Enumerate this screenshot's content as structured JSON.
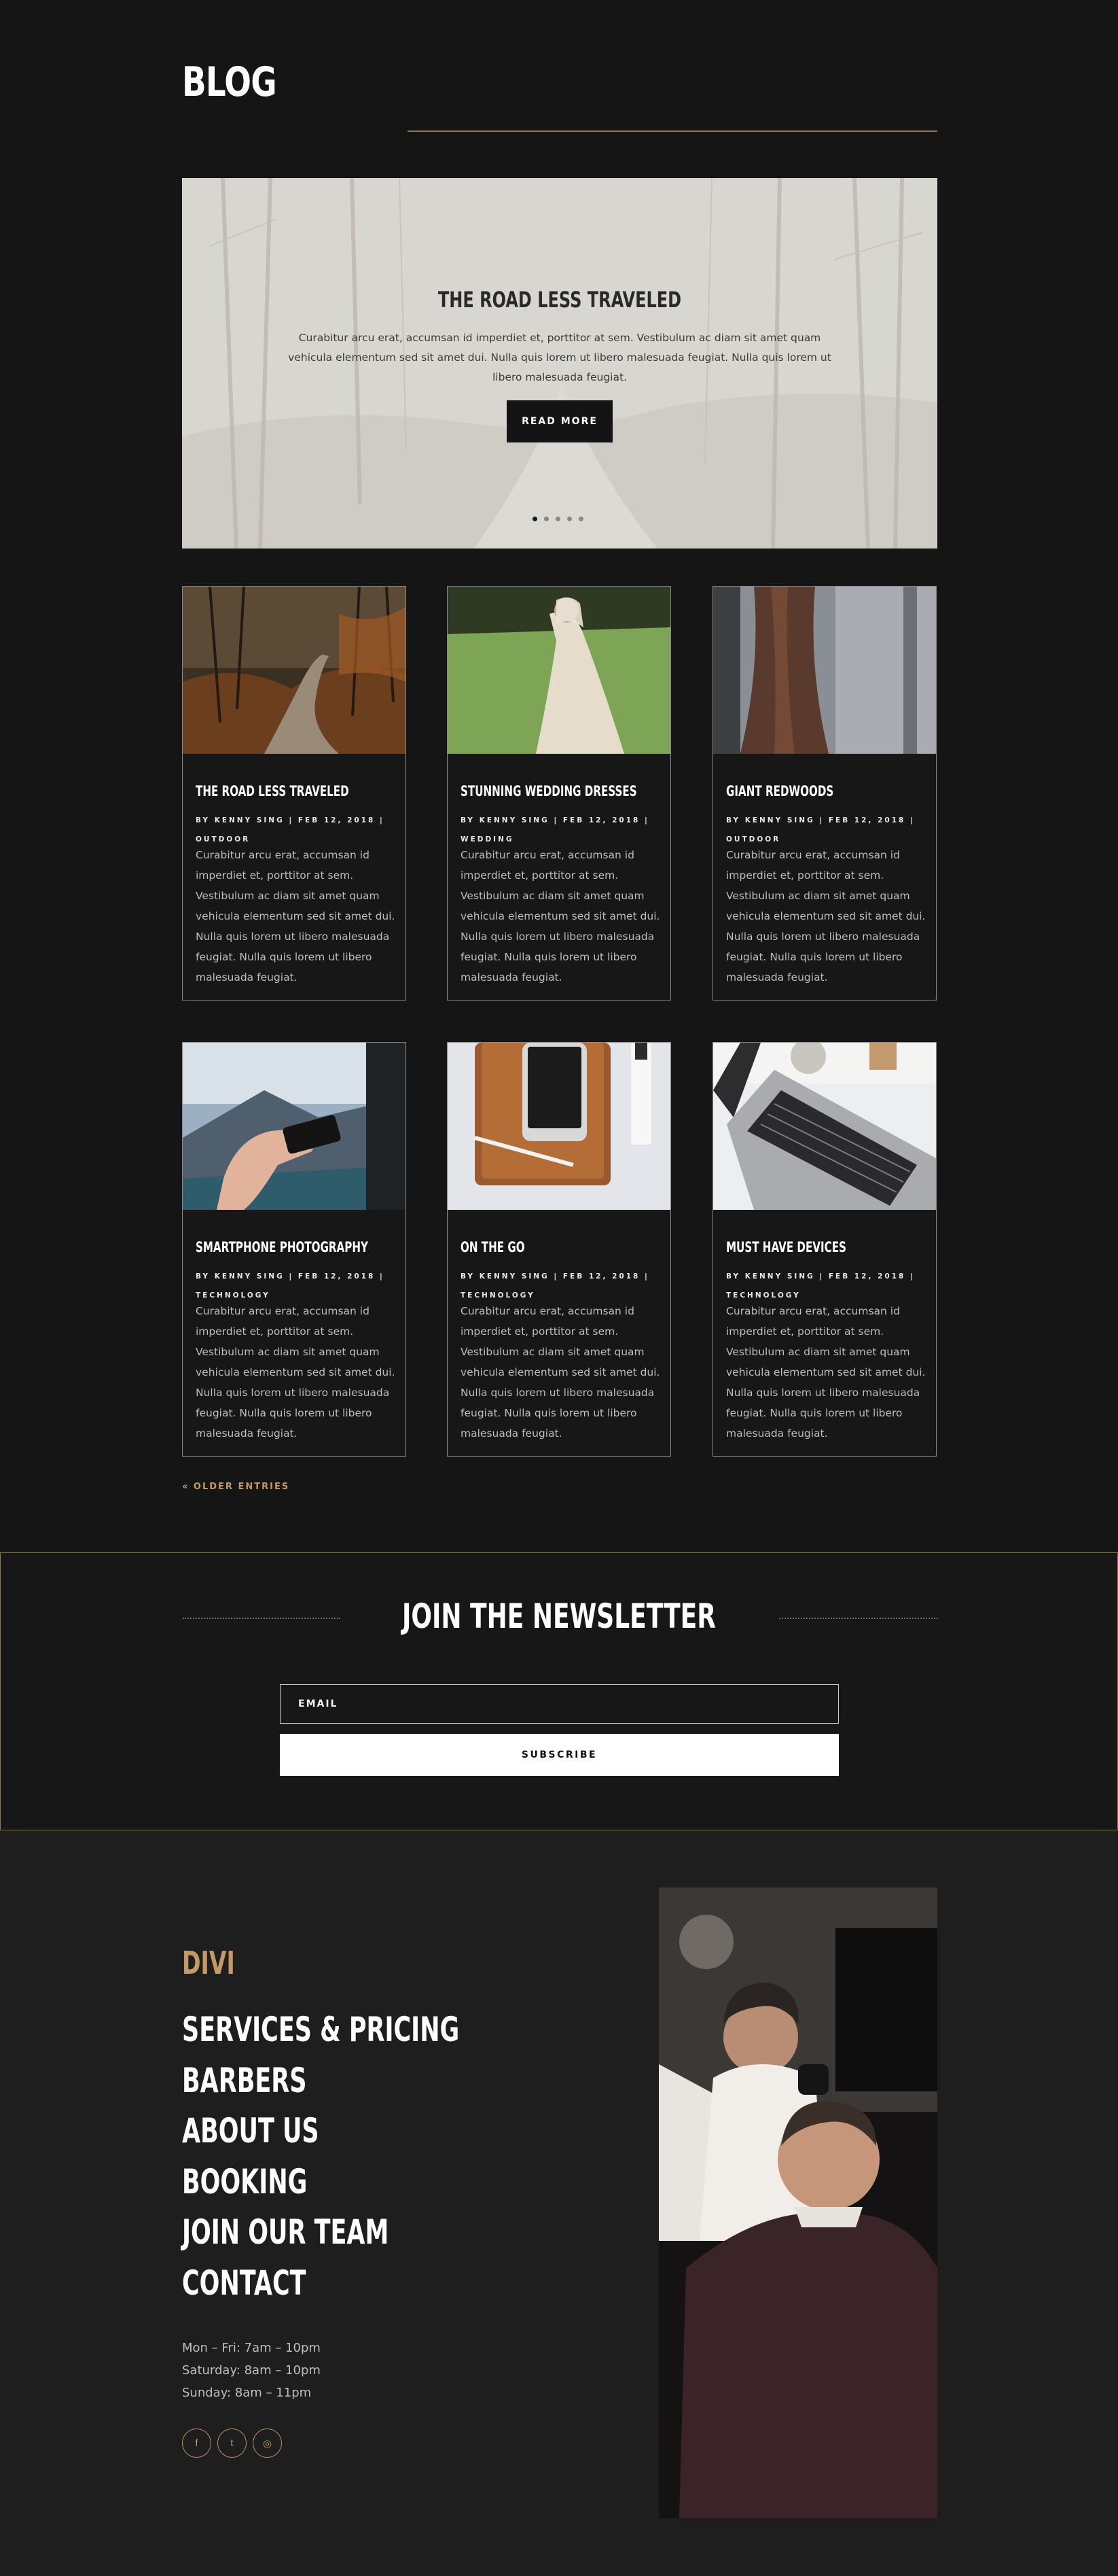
{
  "blog": {
    "title": "BLOG"
  },
  "slider": {
    "title": "THE ROAD LESS TRAVELED",
    "text": "Curabitur arcu erat, accumsan id imperdiet et, porttitor at sem. Vestibulum ac diam sit amet quam vehicula elementum sed sit amet dui. Nulla quis lorem ut libero malesuada feugiat. Nulla quis lorem ut libero malesuada feugiat.",
    "button": "READ MORE",
    "slide_count": 5,
    "active_slide": 1
  },
  "posts": [
    {
      "title": "THE ROAD LESS TRAVELED",
      "meta_line1": "BY KENNY SING | FEB 12, 2018 |",
      "meta_line2": "OUTDOOR",
      "excerpt": "Curabitur arcu erat, accumsan id imperdiet et, porttitor at sem. Vestibulum ac diam sit amet quam vehicula elementum sed sit amet dui. Nulla quis lorem ut libero malesuada feugiat. Nulla quis lorem ut libero malesuada feugiat.",
      "image": "forest-road-photo"
    },
    {
      "title": "STUNNING WEDDING DRESSES",
      "meta_line1": "BY KENNY SING | FEB 12, 2018 |",
      "meta_line2": "WEDDING",
      "excerpt": "Curabitur arcu erat, accumsan id imperdiet et, porttitor at sem. Vestibulum ac diam sit amet quam vehicula elementum sed sit amet dui. Nulla quis lorem ut libero malesuada feugiat. Nulla quis lorem ut libero malesuada feugiat.",
      "image": "wedding-dress-photo"
    },
    {
      "title": "GIANT REDWOODS",
      "meta_line1": "BY KENNY SING | FEB 12, 2018 |",
      "meta_line2": "OUTDOOR",
      "excerpt": "Curabitur arcu erat, accumsan id imperdiet et, porttitor at sem. Vestibulum ac diam sit amet quam vehicula elementum sed sit amet dui. Nulla quis lorem ut libero malesuada feugiat. Nulla quis lorem ut libero malesuada feugiat.",
      "image": "redwood-tree-photo"
    },
    {
      "title": "SMARTPHONE PHOTOGRAPHY",
      "meta_line1": "BY KENNY SING | FEB 12, 2018 |",
      "meta_line2": "TECHNOLOGY",
      "excerpt": "Curabitur arcu erat, accumsan id imperdiet et, porttitor at sem. Vestibulum ac diam sit amet quam vehicula elementum sed sit amet dui. Nulla quis lorem ut libero malesuada feugiat. Nulla quis lorem ut libero malesuada feugiat.",
      "image": "smartphone-photo"
    },
    {
      "title": "ON THE GO",
      "meta_line1": "BY KENNY SING | FEB 12, 2018 |",
      "meta_line2": "TECHNOLOGY",
      "excerpt": "Curabitur arcu erat, accumsan id imperdiet et, porttitor at sem. Vestibulum ac diam sit amet quam vehicula elementum sed sit amet dui. Nulla quis lorem ut libero malesuada feugiat. Nulla quis lorem ut libero malesuada feugiat.",
      "image": "tablet-phone-photo"
    },
    {
      "title": "MUST HAVE DEVICES",
      "meta_line1": "BY KENNY SING | FEB 12, 2018 |",
      "meta_line2": "TECHNOLOGY",
      "excerpt": "Curabitur arcu erat, accumsan id imperdiet et, porttitor at sem. Vestibulum ac diam sit amet quam vehicula elementum sed sit amet dui. Nulla quis lorem ut libero malesuada feugiat. Nulla quis lorem ut libero malesuada feugiat.",
      "image": "laptop-photo"
    }
  ],
  "pagination": {
    "older": "« OLDER ENTRIES"
  },
  "newsletter": {
    "title": "JOIN THE NEWSLETTER",
    "email_placeholder": "EMAIL",
    "button": "SUBSCRIBE"
  },
  "footer": {
    "logo": "DIVI",
    "nav": [
      "SERVICES & PRICING",
      "BARBERS",
      "ABOUT US",
      "BOOKING",
      "JOIN OUR TEAM",
      "CONTACT"
    ],
    "hours": [
      "Mon – Fri: 7am – 10pm",
      "Saturday: 8am – 10pm",
      "Sunday: 8am – 11pm"
    ],
    "social": [
      {
        "name": "facebook-icon",
        "glyph": "f"
      },
      {
        "name": "twitter-icon",
        "glyph": "t"
      },
      {
        "name": "instagram-icon",
        "glyph": "◎"
      }
    ],
    "image": "barber-photo"
  },
  "colors": {
    "background": "#151515",
    "accent": "#c49a64",
    "footer_bg": "#1e1e1e"
  }
}
